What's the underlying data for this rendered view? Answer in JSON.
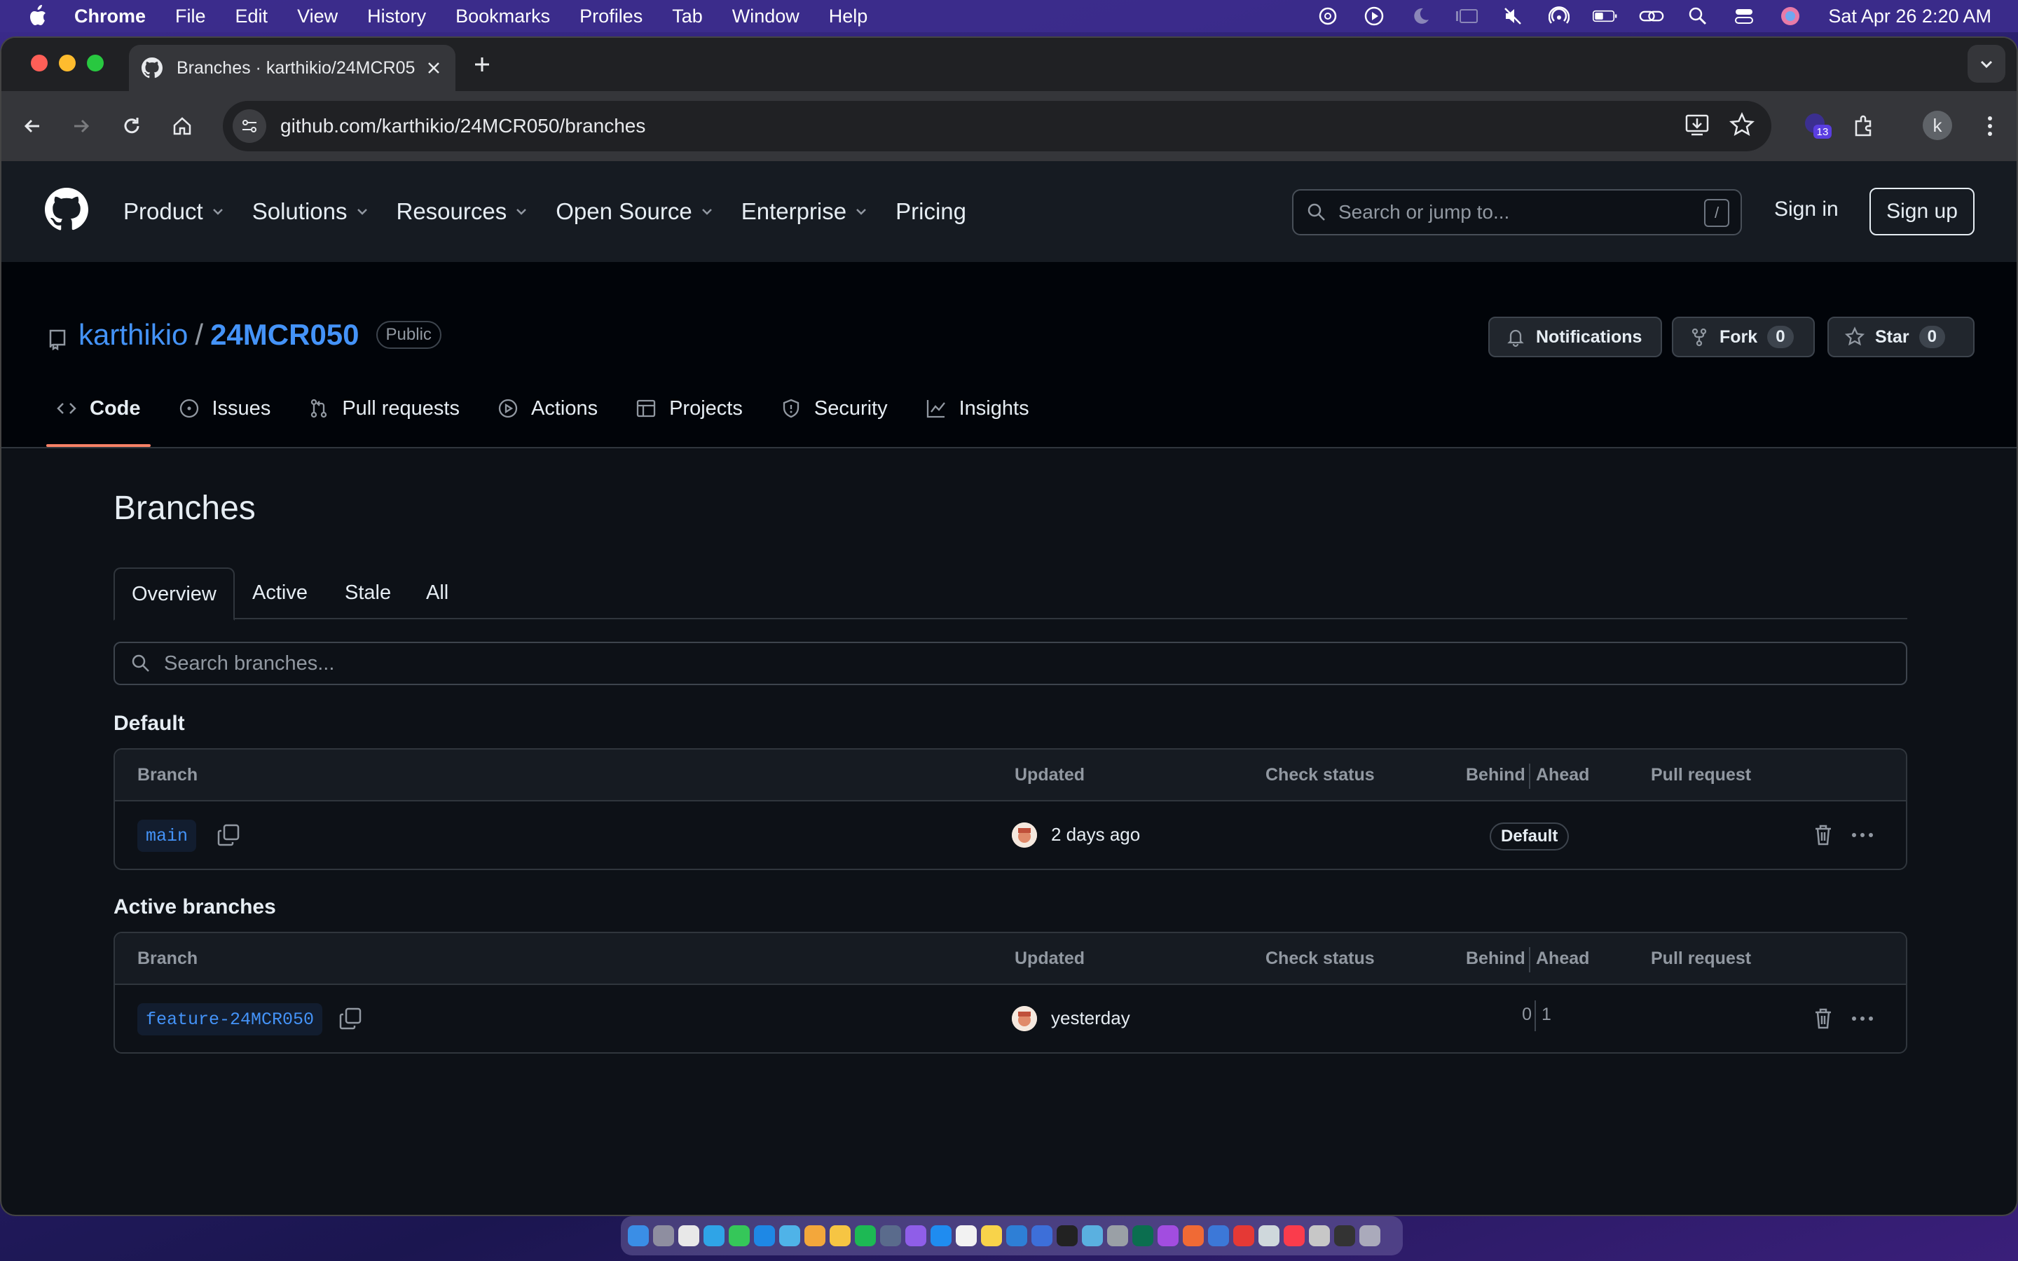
{
  "menubar": {
    "app": "Chrome",
    "items": [
      "File",
      "Edit",
      "View",
      "History",
      "Bookmarks",
      "Profiles",
      "Tab",
      "Window",
      "Help"
    ],
    "clock": "Sat Apr 26  2:20 AM"
  },
  "browser": {
    "tab_title": "Branches · karthikio/24MCR050",
    "url": "github.com/karthikio/24MCR050/branches",
    "extension_badge": "13",
    "profile_initial": "k"
  },
  "github": {
    "nav": [
      "Product",
      "Solutions",
      "Resources",
      "Open Source",
      "Enterprise",
      "Pricing"
    ],
    "search_placeholder": "Search or jump to...",
    "search_shortcut": "/",
    "sign_in": "Sign in",
    "sign_up": "Sign up"
  },
  "repo": {
    "owner": "karthikio",
    "separator": "/",
    "name": "24MCR050",
    "visibility": "Public",
    "notifications": "Notifications",
    "fork_label": "Fork",
    "fork_count": "0",
    "star_label": "Star",
    "star_count": "0",
    "tabs": [
      "Code",
      "Issues",
      "Pull requests",
      "Actions",
      "Projects",
      "Security",
      "Insights"
    ]
  },
  "branches": {
    "title": "Branches",
    "subtabs": [
      "Overview",
      "Active",
      "Stale",
      "All"
    ],
    "search_placeholder": "Search branches...",
    "columns": {
      "branch": "Branch",
      "updated": "Updated",
      "check_status": "Check status",
      "behind": "Behind",
      "ahead": "Ahead",
      "pull_request": "Pull request"
    },
    "default_section": {
      "heading": "Default",
      "rows": [
        {
          "name": "main",
          "updated": "2 days ago",
          "badge": "Default"
        }
      ]
    },
    "active_section": {
      "heading": "Active branches",
      "rows": [
        {
          "name": "feature-24MCR050",
          "updated": "yesterday",
          "behind": "0",
          "ahead": "1"
        }
      ]
    }
  },
  "colors": {
    "accent_link": "#4493f8",
    "tab_underline": "#f78166",
    "page_bg": "#0d1117"
  }
}
